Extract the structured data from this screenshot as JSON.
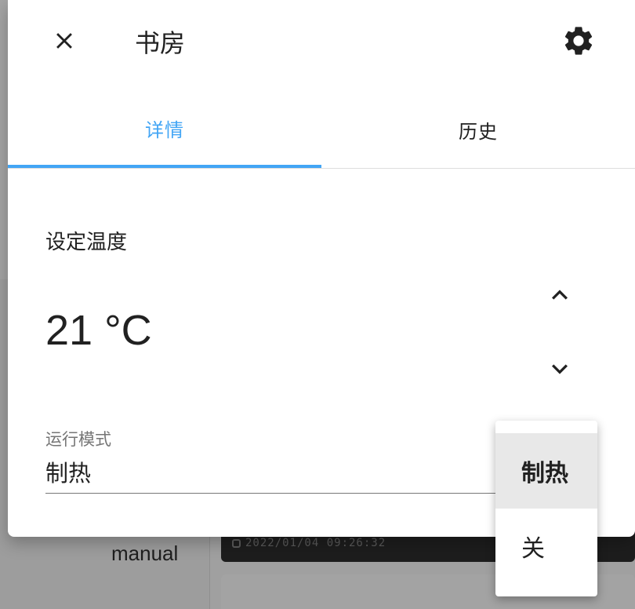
{
  "dialog": {
    "title": "书房",
    "tabs": [
      {
        "label": "详情",
        "active": true
      },
      {
        "label": "历史",
        "active": false
      }
    ]
  },
  "thermostat": {
    "target_label": "设定温度",
    "target_value": "21 °C",
    "mode_label": "运行模式",
    "mode_value": "制热"
  },
  "dropdown": {
    "options": [
      {
        "label": "制热",
        "selected": true
      },
      {
        "label": "关",
        "selected": false
      }
    ]
  },
  "background": {
    "mode_text": "manual",
    "camera_timestamp": "2022/01/04 09:26:32"
  },
  "colors": {
    "accent": "#42a5f5",
    "text": "#212121",
    "scrim": "#9c9c9c"
  },
  "icons": {
    "close": "close-icon",
    "settings": "gear-icon",
    "up": "chevron-up-icon",
    "down": "chevron-down-icon"
  }
}
